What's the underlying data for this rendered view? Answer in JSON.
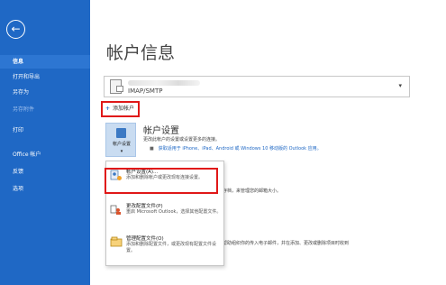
{
  "sidebar": {
    "items": [
      {
        "label": "信息",
        "active": true
      },
      {
        "label": "打开和导出",
        "active": false
      },
      {
        "label": "另存为",
        "active": false
      },
      {
        "label": "另存附件",
        "active": false
      },
      {
        "label": "打印",
        "active": false
      },
      {
        "label": "Office 帐户",
        "active": false
      },
      {
        "label": "反馈",
        "active": false
      },
      {
        "label": "选项",
        "active": false
      }
    ],
    "back_icon": "←"
  },
  "main": {
    "title": "帐户信息",
    "account": {
      "type": "IMAP/SMTP",
      "chevron": "▾"
    },
    "add_account": {
      "plus": "+",
      "label": "添加帐户"
    },
    "account_settings": {
      "button_label": "帐户设置",
      "button_arrow": "▾",
      "heading": "帐户设置",
      "description": "更改此帐户的设置或设置更多的连接。",
      "bullet": "获取适用于 iPhone、iPad、Android 或 Windows 10 移动版的 Outlook 应用。"
    },
    "background_texts": {
      "mailbox_cleanup": "存档，来管理您的邮箱大小。",
      "rules": "帮助组织你的传入电子邮件，并在添加、更改或删除项目时收到"
    }
  },
  "menu": {
    "items": [
      {
        "title": "帐户设置(A)...",
        "desc": "添加和删除帐户或更改现有连接设置。"
      },
      {
        "title": "更改配置文件(P)",
        "desc": "重启 Microsoft Outlook，选择其他配置文件。"
      },
      {
        "title": "管理配置文件(O)",
        "desc": "添加和删除配置文件，或更改现有配置文件设置。"
      }
    ]
  },
  "colors": {
    "sidebar": "#1f68c5",
    "highlight": "#e01818",
    "link": "#1f68c5"
  }
}
